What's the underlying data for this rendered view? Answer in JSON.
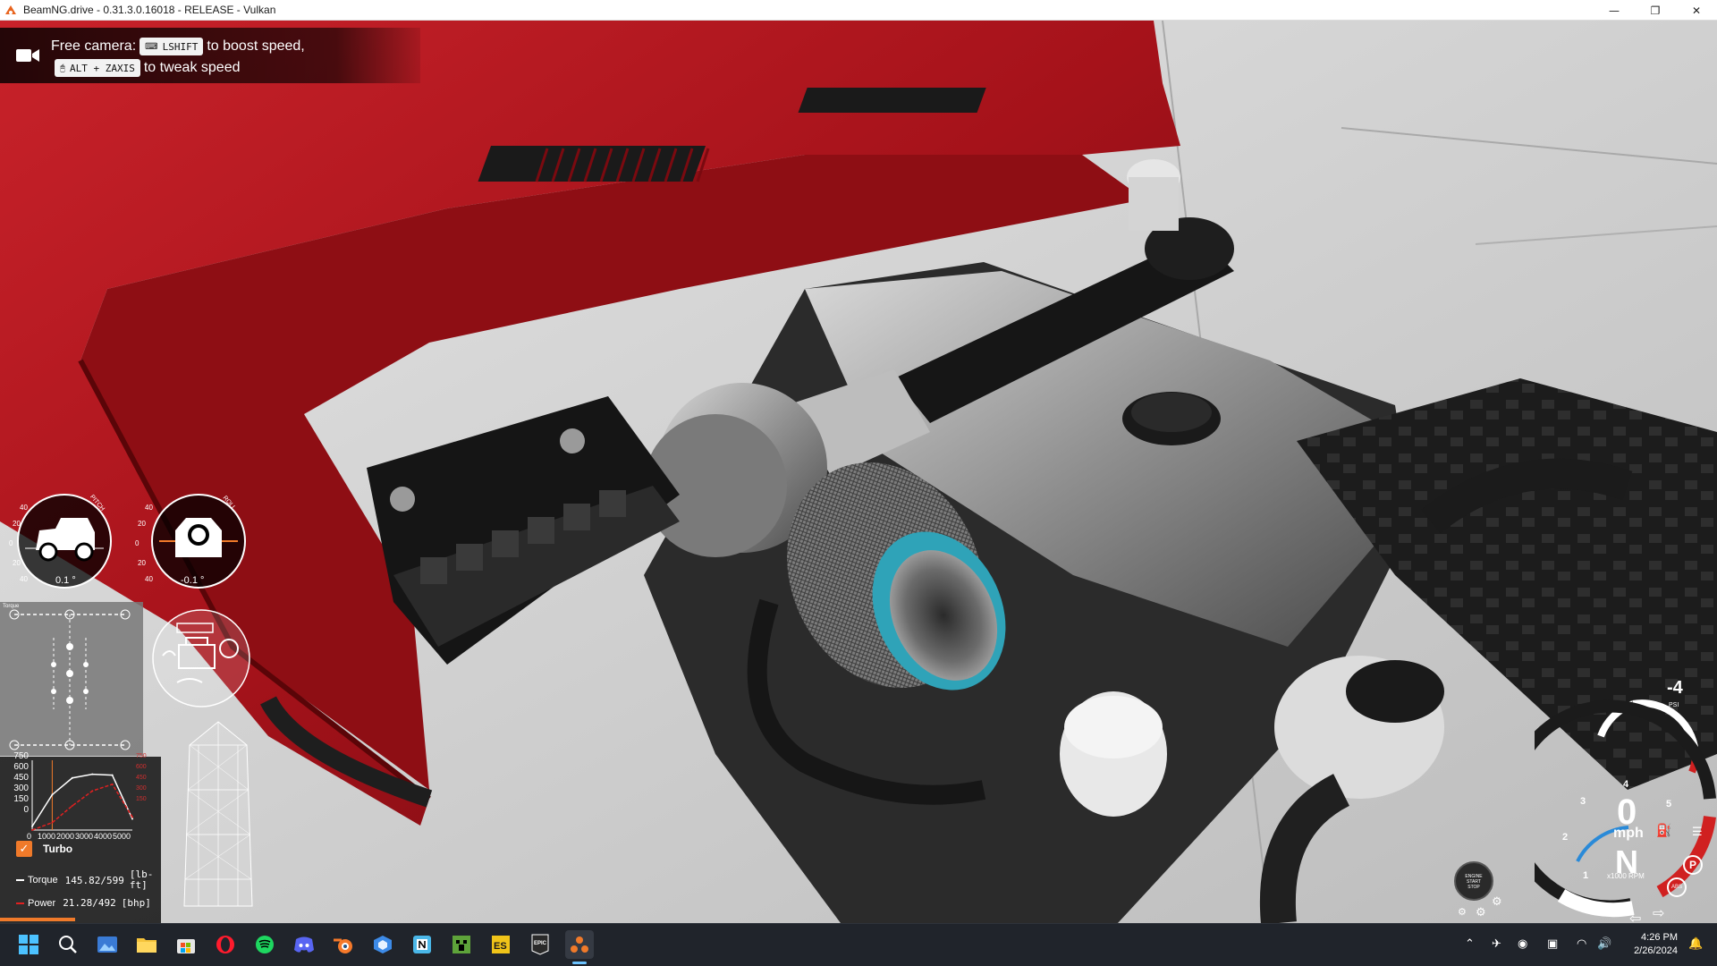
{
  "window": {
    "title": "BeamNG.drive - 0.31.3.0.16018 - RELEASE - Vulkan",
    "minimize": "—",
    "maximize": "❐",
    "close": "✕"
  },
  "camera_hint": {
    "line1_prefix": "Free camera:",
    "line1_key": "LSHIFT",
    "line1_suffix": "to boost speed,",
    "line2_key": "ALT + ZAXIS",
    "line2_suffix": "to tweak speed",
    "icon": "video-camera-icon"
  },
  "attitude": {
    "pitch_label": "PITCH",
    "pitch_value": "0.1 °",
    "roll_label": "ROLL",
    "roll_value": "-0.1 °",
    "ticks": [
      "40",
      "20",
      "0",
      "20",
      "40"
    ]
  },
  "forces_panel": {
    "label": "Torque"
  },
  "torque_chart": {
    "y_ticks": [
      "750",
      "600",
      "450",
      "300",
      "150",
      "0"
    ],
    "x_ticks": [
      "0",
      "1000",
      "2000",
      "3000",
      "4000",
      "5000"
    ],
    "turbo_label": "Turbo",
    "torque_label": "Torque",
    "torque_value": "145.82/599",
    "torque_unit_1": "[lb-",
    "torque_unit_2": "ft]",
    "power_label": "Power",
    "power_value": "21.28/492",
    "power_unit": "[bhp]"
  },
  "chart_data": {
    "type": "line",
    "x": [
      0,
      1000,
      2000,
      3000,
      4000,
      5000
    ],
    "ylim": [
      0,
      750
    ],
    "xlim": [
      0,
      5000
    ],
    "series": [
      {
        "name": "Torque",
        "color": "#ffffff",
        "values": [
          40,
          380,
          560,
          600,
          590,
          120
        ]
      },
      {
        "name": "Power",
        "color": "#e02020",
        "values": [
          0,
          80,
          260,
          420,
          492,
          140
        ]
      }
    ]
  },
  "speedo": {
    "boost_value": "-4",
    "boost_unit": "PSI",
    "speed": "0",
    "speed_unit": "mph",
    "gear": "N",
    "rpm_unit": "x1000 RPM",
    "gear_ticks": [
      "1",
      "2",
      "3",
      "4",
      "5"
    ],
    "start_stop_1": "ENGINE",
    "start_stop_2": "START",
    "start_stop_3": "STOP",
    "parking": "P",
    "abs": "ABS"
  },
  "taskbar": {
    "time": "4:26 PM",
    "date": "2/26/2024",
    "apps": [
      "windows-start-icon",
      "search-icon",
      "photos-icon",
      "file-explorer-icon",
      "store-icon",
      "opera-icon",
      "spotify-icon",
      "discord-icon",
      "blender-icon",
      "app-cube-icon",
      "notion-icon",
      "minecraft-icon",
      "es-app-icon",
      "epic-games-icon",
      "beamng-icon"
    ]
  },
  "colors": {
    "accent": "#f07a2a",
    "power": "#e02020",
    "turbo_filter": "#2fa3b8",
    "car_red": "#b3141c"
  }
}
